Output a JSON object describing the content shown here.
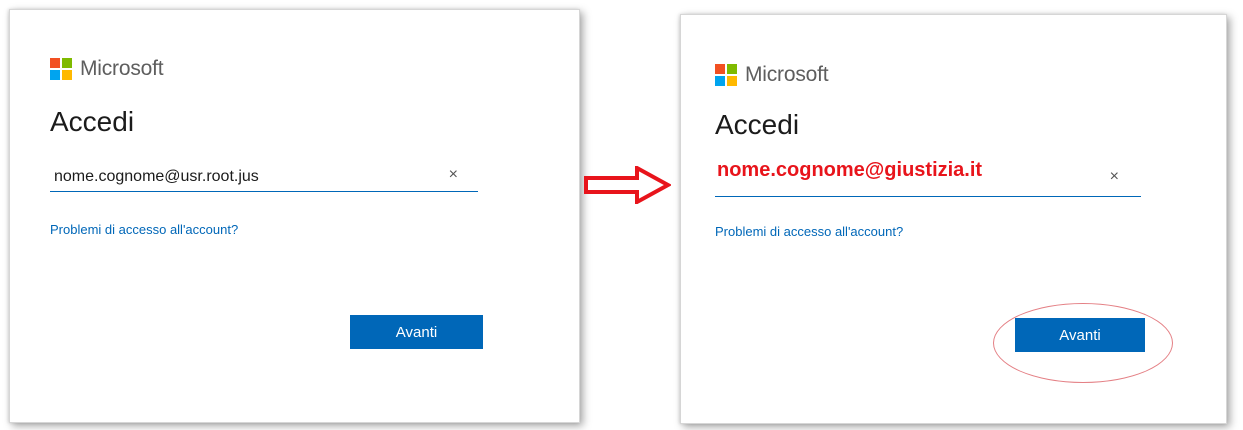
{
  "left_panel": {
    "brand": "Microsoft",
    "title": "Accedi",
    "email_value": "nome.cognome@usr.root.jus",
    "clear_glyph": "×",
    "help_link": "Problemi di accesso all'account?",
    "next_button": "Avanti"
  },
  "right_panel": {
    "brand": "Microsoft",
    "title": "Accedi",
    "email_value": "nome.cognome@giustizia.it",
    "clear_glyph": "×",
    "help_link": "Problemi di accesso all'account?",
    "next_button": "Avanti"
  },
  "icons": {
    "logo": "microsoft-logo",
    "clear": "close-icon",
    "transition": "right-arrow-icon",
    "highlight": "ellipse-highlight"
  },
  "colors": {
    "accent": "#0067b8",
    "logo_red": "#f25022",
    "logo_green": "#7fba00",
    "logo_blue": "#00a4ef",
    "logo_yellow": "#ffb900",
    "annotation_red": "#e8141b",
    "highlight_circle": "#e47f84"
  }
}
